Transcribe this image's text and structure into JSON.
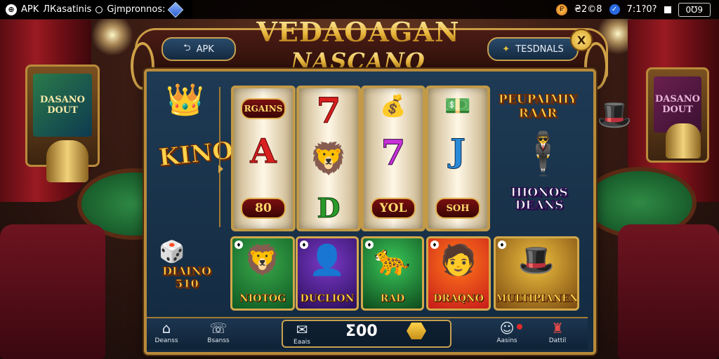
{
  "status_bar": {
    "app_label": "APK",
    "text1": "ЛКasatinis",
    "text2": "Gjmpronnos:",
    "coins_text": "₴2©8",
    "gems_text": "7:1?0?",
    "pill_text": "0Ʊ9"
  },
  "header": {
    "title_line1": "VEDAOAGAN",
    "title_line2": "NASCANO",
    "left_button": "APK",
    "right_button": "TESDNALS",
    "close_label": "X"
  },
  "side": {
    "left_label": "KINO",
    "left_bottom_label": "DIAINO 510",
    "right_top_label": "PEUPAIMIY RAAR",
    "right_bottom_label": "HIONOS DEANS"
  },
  "reels": [
    {
      "top": "RGAINS",
      "mid": "A",
      "bottom": "80"
    },
    {
      "top": "7",
      "mid": "",
      "bottom": "D"
    },
    {
      "top": "",
      "mid": "7",
      "bottom": "YOL"
    },
    {
      "top": "",
      "mid": "J",
      "bottom": "SOH"
    }
  ],
  "cards": [
    {
      "title": "NIOTOG",
      "colors": [
        "#3aa84a",
        "#0e5a24"
      ],
      "icon": "lion-icon"
    },
    {
      "title": "DUCLION",
      "colors": [
        "#7a3ac8",
        "#2a0e5a"
      ],
      "icon": "man-icon"
    },
    {
      "title": "RAD",
      "colors": [
        "#3ac85a",
        "#0e4a1c"
      ],
      "icon": "panther-icon"
    },
    {
      "title": "DRAQNO",
      "colors": [
        "#ff7a1a",
        "#c81a1a"
      ],
      "icon": "portrait-icon"
    },
    {
      "title": "MULTIPIANEN",
      "colors": [
        "#f0c040",
        "#7a4a10"
      ],
      "icon": "hat-man-icon"
    }
  ],
  "bg": {
    "left_screen": "DASANO DOUT",
    "right_screen": "DASANO DOUT"
  },
  "nav": {
    "home": "Deanss",
    "phone": "Bsanss",
    "center_left": "Eaais",
    "center_num": "Ʃ00",
    "profile": "Aasins",
    "last": "Dattil"
  },
  "colors": {
    "gold": "#d2a84a",
    "panel": "#1e3a54",
    "red": "#9a1a22"
  }
}
